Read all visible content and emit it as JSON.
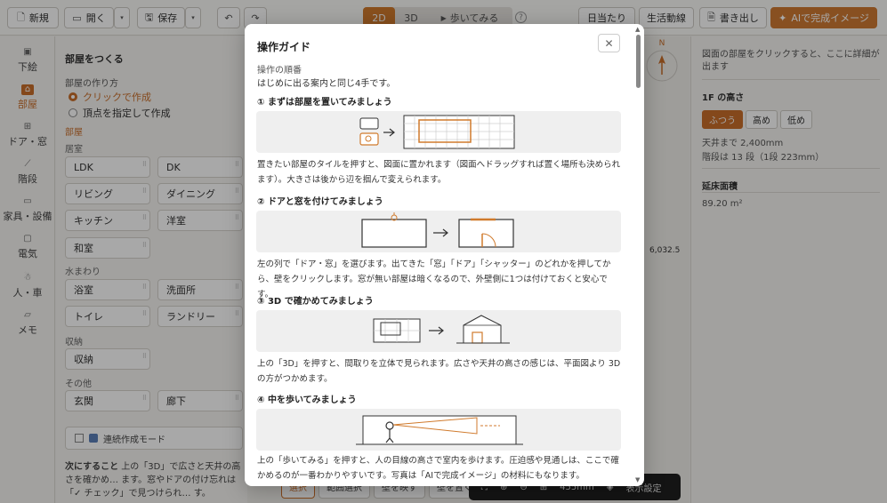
{
  "toolbar": {
    "new_label": "新規",
    "open_label": "開く",
    "save_label": "保存",
    "undo_icon": "undo-icon",
    "redo_icon": "redo-icon",
    "view_2d": "2D",
    "view_3d": "3D",
    "walk_label": "歩いてみる",
    "help_mark": "?",
    "sunlight_label": "日当たり",
    "flow_label": "生活動線",
    "export_label": "書き出し",
    "ai_label": "AIで完成イメージ"
  },
  "rail": {
    "items": [
      {
        "label": "下絵",
        "icon": "image-icon"
      },
      {
        "label": "部屋",
        "icon": "room-icon",
        "active": true
      },
      {
        "label": "ドア・窓",
        "icon": "door-window-icon"
      },
      {
        "label": "階段",
        "icon": "stairs-icon"
      },
      {
        "label": "家具・設備",
        "icon": "furniture-icon"
      },
      {
        "label": "電気",
        "icon": "electric-icon"
      },
      {
        "label": "人・車",
        "icon": "person-icon"
      },
      {
        "label": "メモ",
        "icon": "memo-icon"
      }
    ]
  },
  "left_panel": {
    "title": "部屋をつくる",
    "method_label": "部屋の作り方",
    "method_click": "クリックで作成",
    "method_vertex": "頂点を指定して作成",
    "rooms_label": "部屋",
    "living_label": "居室",
    "living_rooms": [
      "LDK",
      "DK",
      "リビング",
      "ダイニング",
      "キッチン",
      "洋室",
      "和室"
    ],
    "water_label": "水まわり",
    "water_rooms": [
      "浴室",
      "洗面所",
      "トイレ",
      "ランドリー"
    ],
    "storage_label": "収納",
    "storage_rooms": [
      "収納"
    ],
    "other_label": "その他",
    "other_rooms": [
      "玄関",
      "廊下"
    ],
    "continuous_label": "連続作成モード",
    "next_head": "次にすること",
    "next_text": "上の「3D」で広さと天井の高さを確かめ… ます。窓やドアの付け忘れは「✓ チェック」で見つけられ… す。"
  },
  "canvas": {
    "compass_label": "N",
    "dimension": "6,032.5",
    "tools": [
      "選択",
      "範囲選択",
      "壁を映す",
      "壁を置く"
    ],
    "zoom": "455mm",
    "display_settings": "表示設定"
  },
  "right_panel": {
    "hint": "図面の部屋をクリックすると、ここに詳細が出ます",
    "height_title": "1F の高さ",
    "height_options": [
      "ふつう",
      "高め",
      "低め"
    ],
    "ceiling": "天井まで 2,400mm",
    "stairs": "階段は 13 段（1段 223mm）",
    "area_title": "延床面積",
    "area_value": "89.20 m²"
  },
  "modal": {
    "title": "操作ガイド",
    "close_icon": "close-icon",
    "order_label": "操作の順番",
    "intro": "はじめに出る案内と同じ4手です。",
    "steps": [
      {
        "title": "① まずは部屋を置いてみましょう",
        "desc": "置きたい部屋のタイルを押すと、図面に置かれます（図面へドラッグすれば置く場所も決められます）。大きさは後から辺を掴んで変えられます。"
      },
      {
        "title": "② ドアと窓を付けてみましょう",
        "desc": "左の列で「ドア・窓」を選びます。出てきた「窓」「ドア」「シャッター」のどれかを押してから、壁をクリックします。窓が無い部屋は暗くなるので、外壁側に1つは付けておくと安心です。"
      },
      {
        "title": "③ 3D で確かめてみましょう",
        "desc": "上の「3D」を押すと、間取りを立体で見られます。広さや天井の高さの感じは、平面図より 3D の方がつかめます。"
      },
      {
        "title": "④ 中を歩いてみましょう",
        "desc": "上の「歩いてみる」を押すと、人の目線の高さで室内を歩けます。圧迫感や見通しは、ここで確かめるのが一番わかりやすいです。写真は「AIで完成イメージ」の材料にもなります。"
      }
    ]
  },
  "colors": {
    "accent": "#c86e2a",
    "overlay": "rgba(0,0,0,0.34)"
  }
}
